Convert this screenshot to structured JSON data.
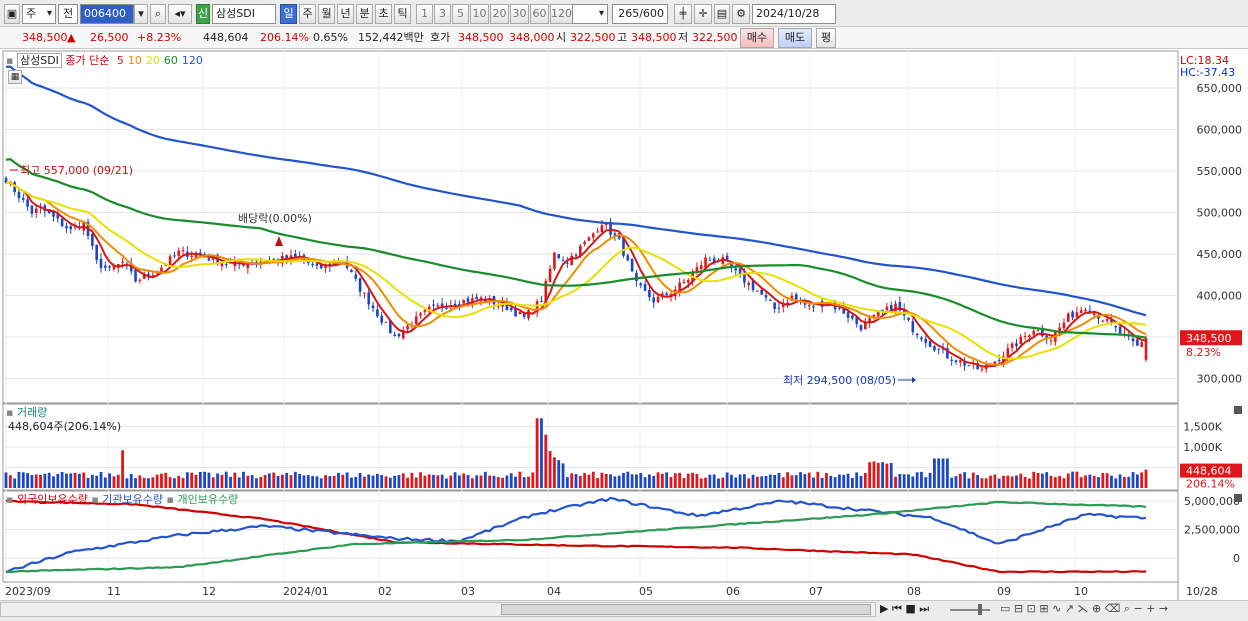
{
  "toolbar": {
    "market": "주",
    "mode": "전",
    "code": "006400",
    "new_badge": "신",
    "stock_name": "삼성SDI",
    "periods": [
      "일",
      "주",
      "월",
      "년",
      "분",
      "초",
      "틱"
    ],
    "selected_period": "일",
    "counts": [
      "1",
      "3",
      "5",
      "10",
      "20",
      "30",
      "60",
      "120"
    ],
    "bar_count": "265",
    "bar_max": "/600",
    "date": "2024/10/28"
  },
  "info": {
    "price": "348,500",
    "change": "26,500",
    "change_pct": "+8.23%",
    "volume": "448,604",
    "volume_ratio": "206.14%",
    "turnover": "0.65%",
    "amount": "152,442백만",
    "ask_label": "호가",
    "ask1": "348,500",
    "ask2": "348,000",
    "open_label": "시",
    "open": "322,500",
    "high_label": "고",
    "high": "348,500",
    "low_label": "저",
    "low": "322,500",
    "buy": "매수",
    "sell": "매도",
    "avg": "평"
  },
  "price_pane": {
    "legend_name": "삼성SDI",
    "legend_type": "종가 단순",
    "ma_periods": [
      "5",
      "10",
      "20",
      "60",
      "120"
    ],
    "ma_colors": [
      "#d11a1a",
      "#f08c00",
      "#e8e000",
      "#1a8c2c",
      "#2255cc"
    ],
    "lc": "LC:18.34",
    "hc": "HC:-37.43",
    "high_note": "최고 557,000 (09/21)",
    "low_note": "최저 294,500 (08/05)",
    "dividend_note": "배당락(0.00%)",
    "last_label": "348,500",
    "last_pct": "8.23%",
    "y_ticks": [
      "650,000",
      "600,000",
      "550,000",
      "500,000",
      "450,000",
      "400,000",
      "350,000",
      "300,000"
    ]
  },
  "volume_pane": {
    "title": "거래량",
    "value_note": "448,604주(206.14%)",
    "last_label": "448,604",
    "last_pct": "206.14%",
    "y_ticks": [
      "1,500K",
      "1,000K",
      "500K"
    ]
  },
  "holding_pane": {
    "legends": [
      "외국인보유수량",
      "기관보유수량",
      "개인보유수량"
    ],
    "colors": [
      "#d10000",
      "#2255cc",
      "#2a9a55"
    ],
    "y_ticks": [
      "5,000,000",
      "2,500,000",
      "0"
    ]
  },
  "x_axis": {
    "labels": [
      "2023/09",
      "11",
      "12",
      "2024/01",
      "02",
      "03",
      "04",
      "05",
      "06",
      "07",
      "08",
      "09",
      "10"
    ],
    "right_label": "10/28"
  },
  "chart_data": {
    "type": "candlestick",
    "x": [
      "2023/09",
      "2024/10/28"
    ],
    "price_ylim": [
      290000,
      665000
    ],
    "price_ticks": [
      300000,
      350000,
      400000,
      450000,
      500000,
      550000,
      600000,
      650000
    ],
    "close_anchors": [
      [
        0,
        540000
      ],
      [
        6,
        500000
      ],
      [
        8,
        505000
      ],
      [
        12,
        490000
      ],
      [
        15,
        478000
      ],
      [
        18,
        488000
      ],
      [
        21,
        440000
      ],
      [
        24,
        430000
      ],
      [
        27,
        440000
      ],
      [
        30,
        418000
      ],
      [
        35,
        430000
      ],
      [
        40,
        452000
      ],
      [
        45,
        448000
      ],
      [
        52,
        437000
      ],
      [
        60,
        442000
      ],
      [
        68,
        446000
      ],
      [
        72,
        432000
      ],
      [
        78,
        443000
      ],
      [
        82,
        408000
      ],
      [
        86,
        378000
      ],
      [
        90,
        350000
      ],
      [
        94,
        367000
      ],
      [
        98,
        383000
      ],
      [
        104,
        392000
      ],
      [
        110,
        396000
      ],
      [
        115,
        389000
      ],
      [
        120,
        373000
      ],
      [
        124,
        395000
      ],
      [
        127,
        450000
      ],
      [
        130,
        442000
      ],
      [
        135,
        468000
      ],
      [
        138,
        488000
      ],
      [
        142,
        465000
      ],
      [
        146,
        413000
      ],
      [
        150,
        394000
      ],
      [
        154,
        404000
      ],
      [
        158,
        420000
      ],
      [
        162,
        444000
      ],
      [
        166,
        442000
      ],
      [
        170,
        422000
      ],
      [
        174,
        406000
      ],
      [
        178,
        384000
      ],
      [
        182,
        398000
      ],
      [
        186,
        386000
      ],
      [
        190,
        392000
      ],
      [
        194,
        380000
      ],
      [
        198,
        362000
      ],
      [
        202,
        377000
      ],
      [
        206,
        388000
      ],
      [
        210,
        360000
      ],
      [
        214,
        342000
      ],
      [
        218,
        327000
      ],
      [
        222,
        318000
      ],
      [
        226,
        310000
      ],
      [
        230,
        325000
      ],
      [
        234,
        342000
      ],
      [
        238,
        360000
      ],
      [
        242,
        348000
      ],
      [
        246,
        374000
      ],
      [
        250,
        387000
      ],
      [
        254,
        372000
      ],
      [
        258,
        355000
      ],
      [
        262,
        338000
      ],
      [
        264,
        348500
      ]
    ],
    "volume_ylim": [
      0,
      1850
    ],
    "volume_unit": "K",
    "volume_ticks": [
      500,
      1000,
      1500
    ],
    "holding_ylim": [
      -1500000,
      5800000
    ],
    "holding_ticks": [
      0,
      2500000,
      5000000
    ],
    "foreign_anchors": [
      [
        0,
        5000000
      ],
      [
        30,
        4700000
      ],
      [
        60,
        3400000
      ],
      [
        90,
        1400000
      ],
      [
        130,
        1100000
      ],
      [
        170,
        900000
      ],
      [
        210,
        300000
      ],
      [
        230,
        -1200000
      ],
      [
        264,
        -1200000
      ]
    ],
    "institution_anchors": [
      [
        0,
        -1200000
      ],
      [
        15,
        500000
      ],
      [
        40,
        2000000
      ],
      [
        60,
        2800000
      ],
      [
        90,
        1700000
      ],
      [
        105,
        1500000
      ],
      [
        122,
        3800000
      ],
      [
        140,
        5200000
      ],
      [
        160,
        3700000
      ],
      [
        180,
        5000000
      ],
      [
        215,
        3500000
      ],
      [
        230,
        1200000
      ],
      [
        250,
        3800000
      ],
      [
        264,
        3500000
      ]
    ],
    "retail_anchors": [
      [
        0,
        -1200000
      ],
      [
        40,
        -800000
      ],
      [
        80,
        1200000
      ],
      [
        120,
        1600000
      ],
      [
        170,
        3000000
      ],
      [
        200,
        3800000
      ],
      [
        230,
        4900000
      ],
      [
        264,
        4500000
      ]
    ],
    "high": {
      "value": 557000,
      "date": "09/21"
    },
    "low": {
      "value": 294500,
      "date": "08/05"
    },
    "last": {
      "close": 348500,
      "change": 26500,
      "change_pct": 8.23,
      "volume": 448604
    }
  }
}
